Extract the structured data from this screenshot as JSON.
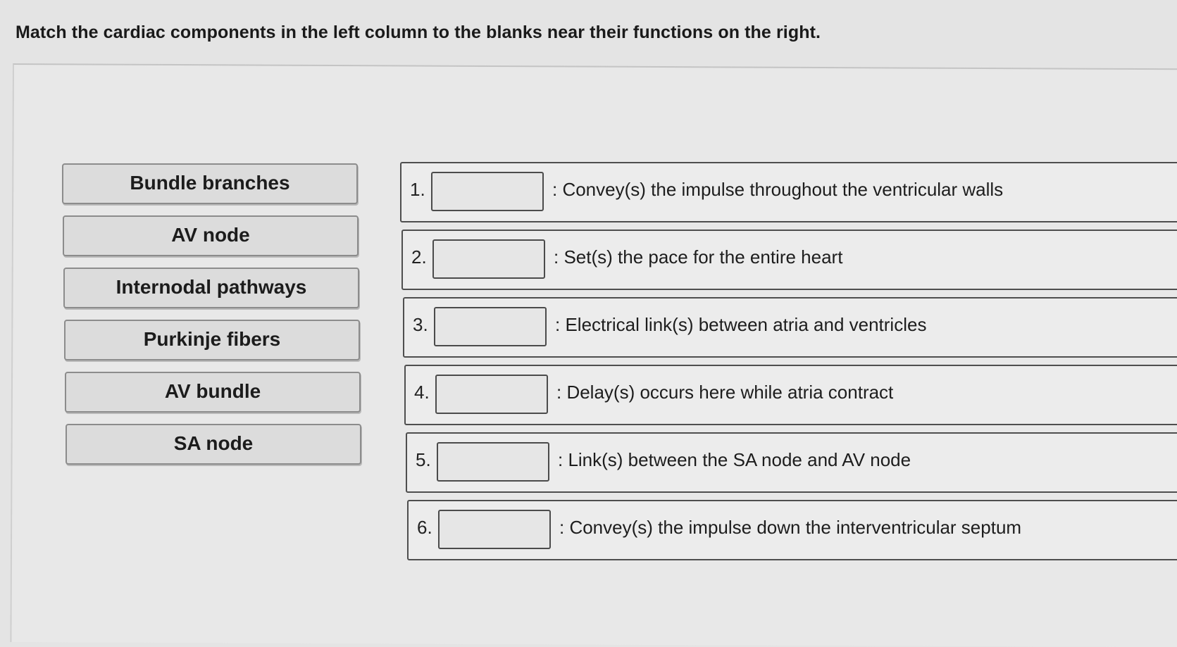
{
  "instruction": "Match the cardiac components in the left column to the blanks near their functions on the right.",
  "answer_choices": [
    "Bundle branches",
    "AV node",
    "Internodal pathways",
    "Purkinje fibers",
    "AV bundle",
    "SA node"
  ],
  "targets": [
    {
      "number": "1.",
      "text": ": Convey(s) the impulse throughout the ventricular walls"
    },
    {
      "number": "2.",
      "text": ": Set(s) the pace for the entire heart"
    },
    {
      "number": "3.",
      "text": ": Electrical link(s) between atria and ventricles"
    },
    {
      "number": "4.",
      "text": ": Delay(s) occurs here while atria contract"
    },
    {
      "number": "5.",
      "text": ": Link(s) between the SA node and AV node"
    },
    {
      "number": "6.",
      "text": ": Convey(s) the impulse down the interventricular septum"
    }
  ]
}
